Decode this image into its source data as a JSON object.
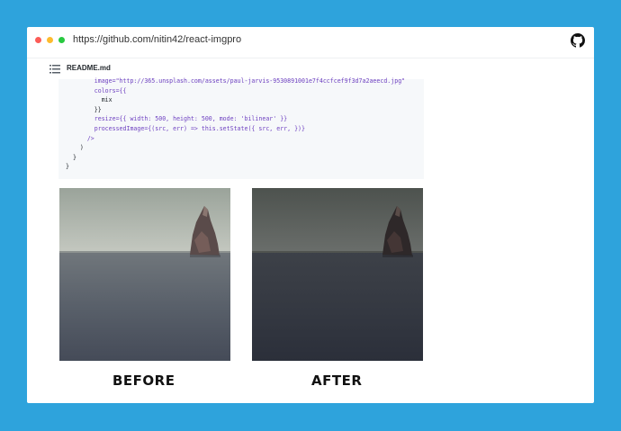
{
  "browser": {
    "url": "https://github.com/nitin42/react-imgpro",
    "window_controls": [
      "close",
      "minimize",
      "zoom"
    ],
    "right_icon": "github-icon"
  },
  "readme": {
    "icon": "list-icon",
    "title": "README.md"
  },
  "code": {
    "line1": "image=\"http://365.unsplash.com/assets/paul-jarvis-9530891001e7f4ccfcef9f3d7a2aeecd.jpg\"",
    "line2": "colors={{",
    "line3": "mix",
    "line4": "}}",
    "line5": "resize={{ width: 500, height: 500, mode: 'bilinear' }}",
    "line6": "processedImage={(src, err) => this.setState({ src, err, })}",
    "line7": "/>",
    "line8": ")",
    "line9": "}",
    "line10": "}"
  },
  "images": {
    "before_label": "BEFORE",
    "after_label": "AFTER"
  },
  "colors": {
    "background": "#2ea3dc",
    "window": "#ffffff",
    "code_bg": "#f6f8fa"
  }
}
